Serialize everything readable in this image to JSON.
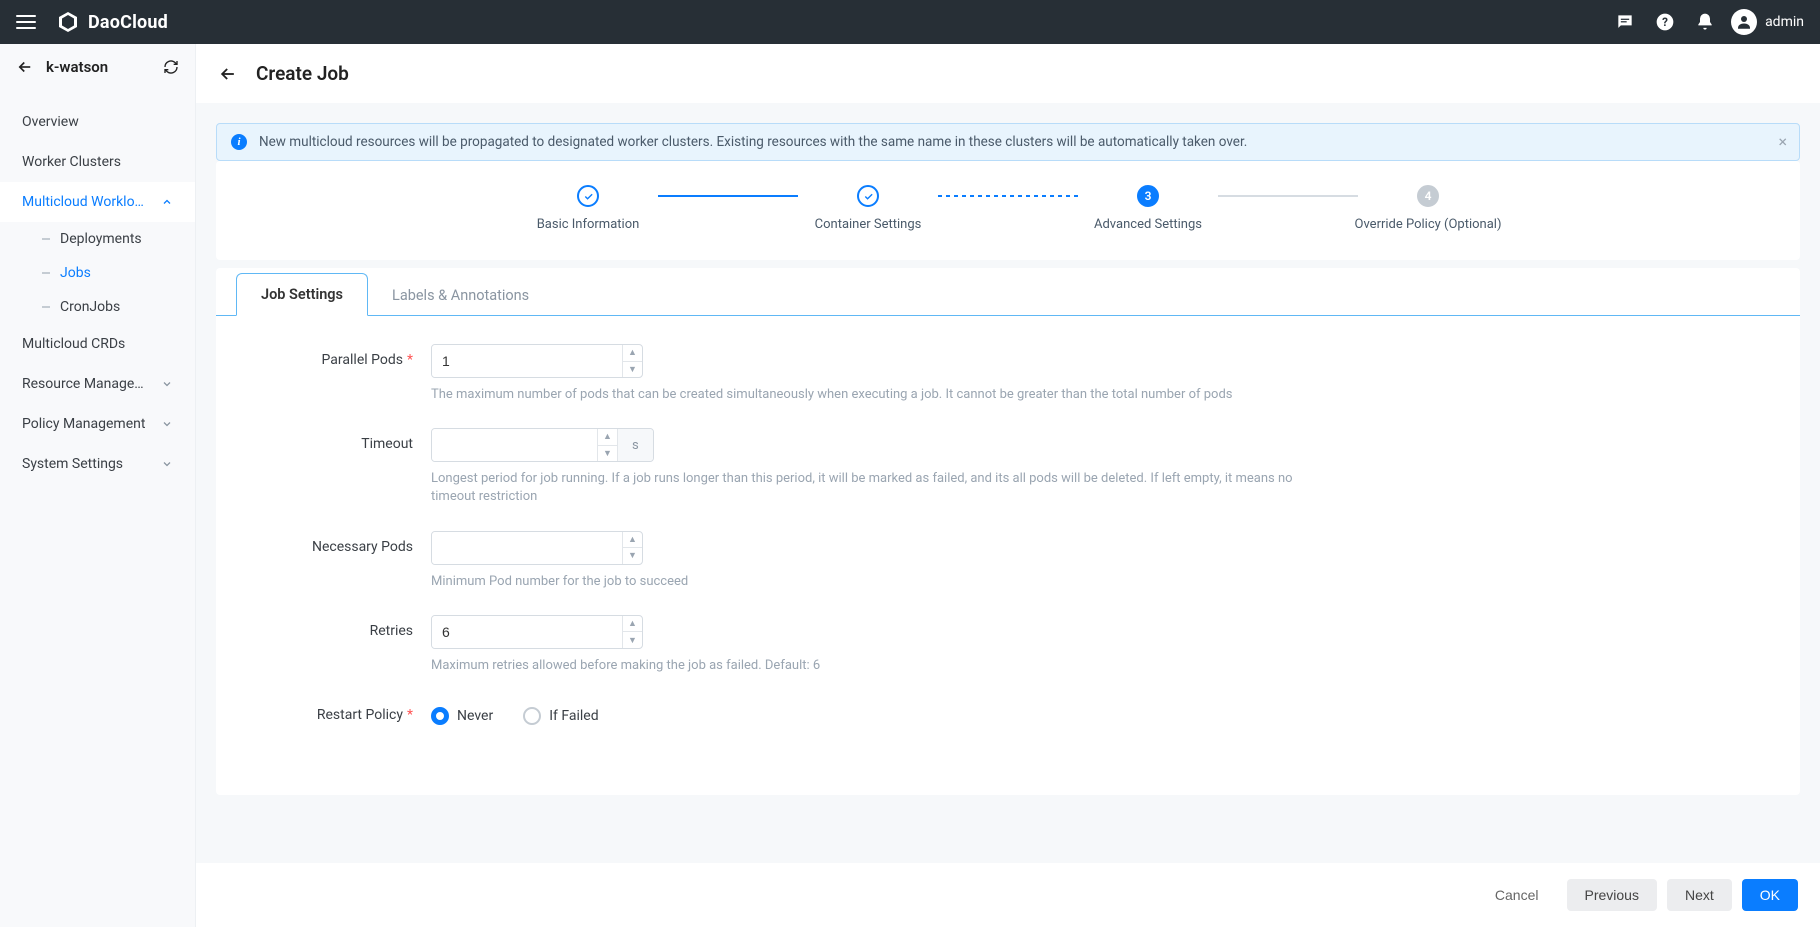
{
  "brand": "DaoCloud",
  "user": {
    "name": "admin"
  },
  "context": {
    "label": "k-watson"
  },
  "sidebar": {
    "overview": "Overview",
    "worker_clusters": "Worker Clusters",
    "multicloud_workloads": "Multicloud Worklo…",
    "deployments": "Deployments",
    "jobs": "Jobs",
    "cronjobs": "CronJobs",
    "multicloud_crds": "Multicloud CRDs",
    "resource_management": "Resource Manage…",
    "policy_management": "Policy Management",
    "system_settings": "System Settings"
  },
  "page": {
    "title": "Create Job"
  },
  "alert": {
    "text": "New multicloud resources will be propagated to designated worker clusters. Existing resources with the same name in these clusters will be automatically taken over."
  },
  "steps": {
    "s1": {
      "label": "Basic Information"
    },
    "s2": {
      "label": "Container Settings"
    },
    "s3": {
      "num": "3",
      "label": "Advanced Settings"
    },
    "s4": {
      "num": "4",
      "label": "Override Policy (Optional)"
    }
  },
  "tabs": {
    "job_settings": "Job Settings",
    "labels_annotations": "Labels & Annotations"
  },
  "form": {
    "parallel_pods": {
      "label": "Parallel Pods",
      "value": "1",
      "help": "The maximum number of pods that can be created simultaneously when executing a job. It cannot be greater than the total number of pods"
    },
    "timeout": {
      "label": "Timeout",
      "value": "",
      "suffix": "s",
      "help": "Longest period for job running. If a job runs longer than this period, it will be marked as failed, and its all pods will be deleted. If left empty, it means no timeout restriction"
    },
    "necessary_pods": {
      "label": "Necessary Pods",
      "value": "",
      "help": "Minimum Pod number for the job to succeed"
    },
    "retries": {
      "label": "Retries",
      "value": "6",
      "help": "Maximum retries allowed before making the job as failed. Default: 6"
    },
    "restart_policy": {
      "label": "Restart Policy",
      "never": "Never",
      "if_failed": "If Failed"
    }
  },
  "footer": {
    "cancel": "Cancel",
    "previous": "Previous",
    "next": "Next",
    "ok": "OK"
  }
}
